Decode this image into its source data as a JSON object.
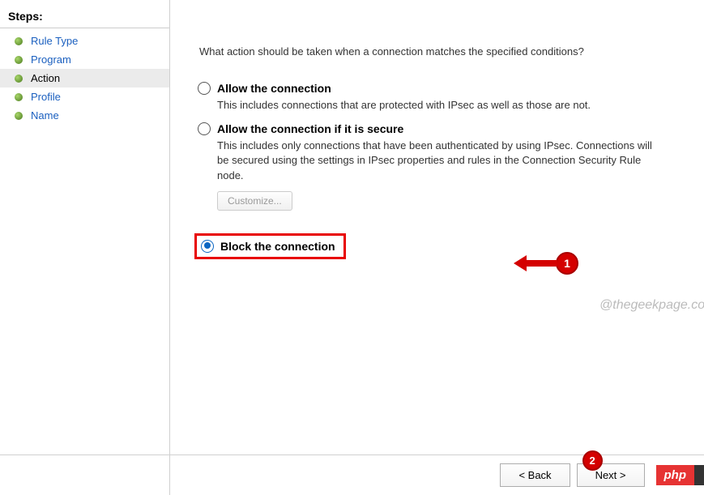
{
  "sidebar": {
    "title": "Steps:",
    "items": [
      {
        "label": "Rule Type"
      },
      {
        "label": "Program"
      },
      {
        "label": "Action"
      },
      {
        "label": "Profile"
      },
      {
        "label": "Name"
      }
    ]
  },
  "main": {
    "question": "What action should be taken when a connection matches the specified conditions?",
    "options": {
      "allow": {
        "title": "Allow the connection",
        "desc": "This includes connections that are protected with IPsec as well as those are not."
      },
      "allow_secure": {
        "title": "Allow the connection if it is secure",
        "desc": "This includes only connections that have been authenticated by using IPsec.  Connections will be secured using the settings in IPsec properties and rules in the Connection Security Rule node.",
        "customize": "Customize..."
      },
      "block": {
        "title": "Block the connection"
      }
    }
  },
  "callouts": {
    "c1": "1",
    "c2": "2"
  },
  "watermark": "@thegeekpage.com",
  "footer": {
    "back": "< Back",
    "next": "Next >"
  },
  "php_tag": "php"
}
